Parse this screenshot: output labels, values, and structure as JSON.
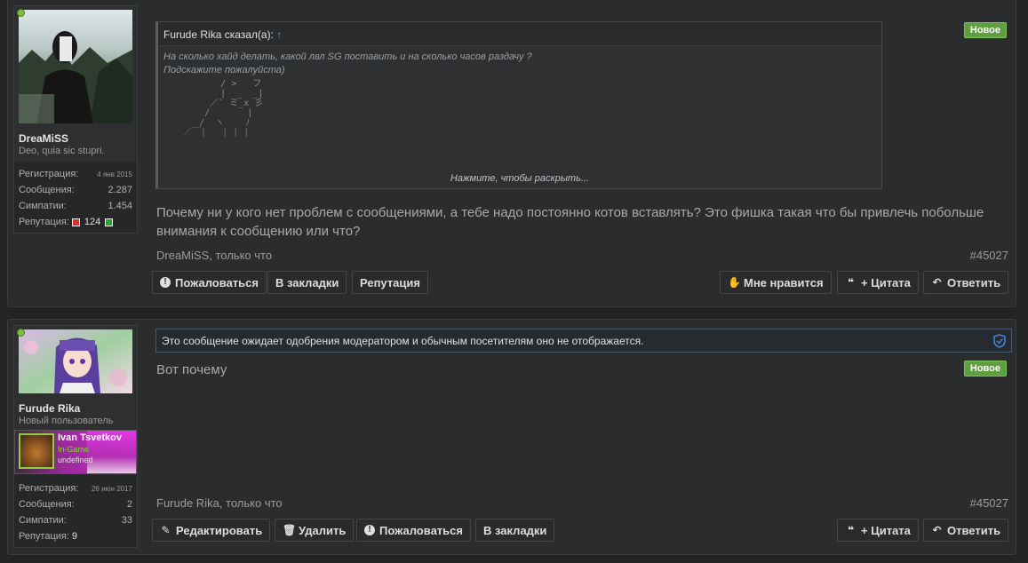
{
  "posts": [
    {
      "author": "DreaMiSS",
      "user_title": "Deo, quia sic stupri.",
      "stats": {
        "reg_label": "Регистрация:",
        "reg_value": "4 янв 2015",
        "msg_label": "Сообщения:",
        "msg_value": "2.287",
        "likes_label": "Симпатии:",
        "likes_value": "1.454",
        "rep_label": "Репутация:",
        "rep_value": "124"
      },
      "badge": "Новое",
      "quote": {
        "author": "Furude Rika сказал(а):",
        "arrow": "↑",
        "line1": "На сколько хайд делать, какой лвл SG поставить и на сколько часов раздачу ?",
        "line2": "Подскажите пожалуйста)",
        "ascii": "         / >   フ\n         |  _  _|\n       ／` ミ_x 彡\n      /       |\n     /  ヽ    ﾉ\n  ／￣|   | | |",
        "expand": "Нажмите, чтобы раскрыть..."
      },
      "message": "Почему ни у кого нет проблем с сообщениями, а тебе надо постоянно котов вставлять? Это фишка такая что бы привлечь побольше внимания к сообщению или что?",
      "meta": "DreaMiSS, только что",
      "post_number": "#45027",
      "buttons_left": [
        "Пожаловаться",
        "В закладки",
        "Репутация"
      ],
      "buttons_right": [
        "Мне нравится",
        "+ Цитата",
        "Ответить"
      ]
    },
    {
      "author": "Furude Rika",
      "user_title": "Новый пользователь",
      "steam": {
        "name": "Ivan Tsvetkov",
        "status": "In-Game",
        "game": "undefined"
      },
      "stats": {
        "reg_label": "Регистрация:",
        "reg_value": "26 июн 2017",
        "msg_label": "Сообщения:",
        "msg_value": "2",
        "likes_label": "Симпатии:",
        "likes_value": "33",
        "rep_label": "Репутация:",
        "rep_value": "9"
      },
      "moderation_notice": "Это сообщение ожидает одобрения модератором и обычным посетителям оно не отображается.",
      "badge": "Новое",
      "message": "Вот почему",
      "meta": "Furude Rika, только что",
      "post_number": "#45027",
      "buttons_left": [
        "Редактировать",
        "Удалить",
        "Пожаловаться",
        "В закладки"
      ],
      "buttons_right": [
        "+ Цитата",
        "Ответить"
      ]
    }
  ],
  "colors": {
    "background": "#222324",
    "post_bg": "#2b2c2d",
    "badge_green": "#5f9f3f",
    "online": "#7fbf3f",
    "link_blue": "#5a9fdf"
  }
}
